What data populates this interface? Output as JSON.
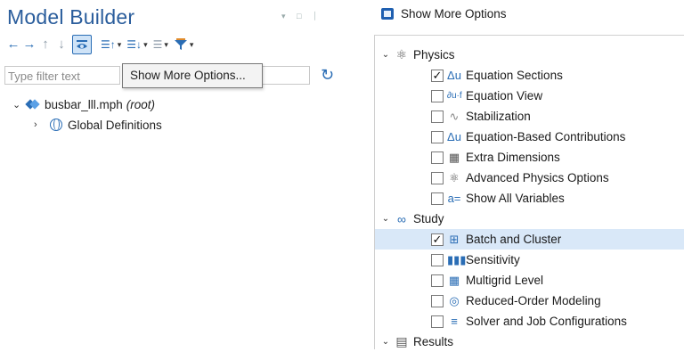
{
  "model_builder": {
    "title": "Model Builder",
    "filter_placeholder": "Type filter text",
    "tooltip": "Show More Options...",
    "tree": {
      "root_file": "busbar_lll.mph",
      "root_tag": "(root)",
      "child": "Global Definitions"
    }
  },
  "show_more_options": {
    "title": "Show More Options",
    "categories": [
      {
        "label": "Physics",
        "icon": "atom-icon",
        "items": [
          {
            "label": "Equation Sections",
            "checked": true,
            "icon": "delta-u-icon"
          },
          {
            "label": "Equation View",
            "checked": false,
            "icon": "equation-view-icon"
          },
          {
            "label": "Stabilization",
            "checked": false,
            "icon": "stabilization-icon"
          },
          {
            "label": "Equation-Based Contributions",
            "checked": false,
            "icon": "delta-u-dot-icon"
          },
          {
            "label": "Extra Dimensions",
            "checked": false,
            "icon": "extra-dimensions-icon"
          },
          {
            "label": "Advanced Physics Options",
            "checked": false,
            "icon": "atom-icon"
          },
          {
            "label": "Show All Variables",
            "checked": false,
            "icon": "a-equals-icon"
          }
        ]
      },
      {
        "label": "Study",
        "icon": "study-icon",
        "items": [
          {
            "label": "Batch and Cluster",
            "checked": true,
            "icon": "batch-icon",
            "selected": true
          },
          {
            "label": "Sensitivity",
            "checked": false,
            "icon": "sensitivity-icon"
          },
          {
            "label": "Multigrid Level",
            "checked": false,
            "icon": "multigrid-icon"
          },
          {
            "label": "Reduced-Order Modeling",
            "checked": false,
            "icon": "rom-icon"
          },
          {
            "label": "Solver and Job Configurations",
            "checked": false,
            "icon": "solver-icon"
          }
        ]
      },
      {
        "label": "Results",
        "icon": "results-icon",
        "items": []
      }
    ]
  }
}
